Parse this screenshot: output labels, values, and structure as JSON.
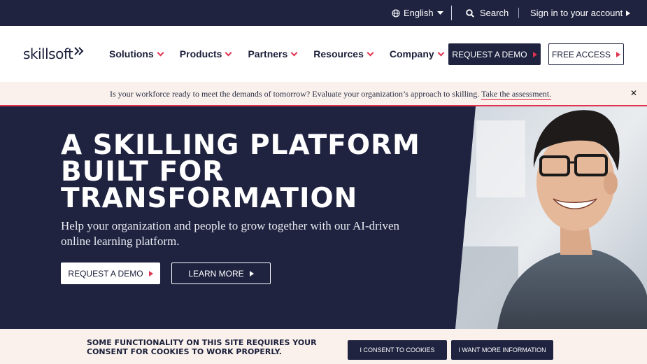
{
  "utility_bar": {
    "language": "English",
    "search_label": "Search",
    "signin_label": "Sign in to your account"
  },
  "nav": {
    "logo_text": "skillsoft",
    "menu": [
      {
        "label": "Solutions"
      },
      {
        "label": "Products"
      },
      {
        "label": "Partners"
      },
      {
        "label": "Resources"
      },
      {
        "label": "Company"
      }
    ],
    "request_demo_label": "REQUEST A DEMO",
    "free_access_label": "FREE ACCESS"
  },
  "announcement": {
    "message": "Is your workforce ready to meet the demands of tomorrow? Evaluate your organization’s approach to skilling.",
    "link_text": "Take the assessment."
  },
  "hero": {
    "title_line1": "A SKILLING PLATFORM",
    "title_line2": "BUILT FOR",
    "title_line3": "TRANSFORMATION",
    "subtitle": "Help your organization and people to grow together with our AI-driven online learning platform.",
    "primary_button": "REQUEST A DEMO",
    "secondary_button": "LEARN MORE"
  },
  "cookie_bar": {
    "message": "SOME FUNCTIONALITY ON THIS SITE REQUIRES YOUR CONSENT FOR COOKIES TO WORK PROPERLY.",
    "consent_button": "I CONSENT TO COOKIES",
    "info_button": "I WANT MORE INFORMATION"
  },
  "colors": {
    "navy": "#1f2340",
    "accent_red": "#e0334f",
    "cream": "#faf1ec"
  },
  "icons": [
    "globe-icon",
    "caret-down-icon",
    "search-icon",
    "play-arrow-icon",
    "close-icon",
    "logo-mark-icon"
  ]
}
